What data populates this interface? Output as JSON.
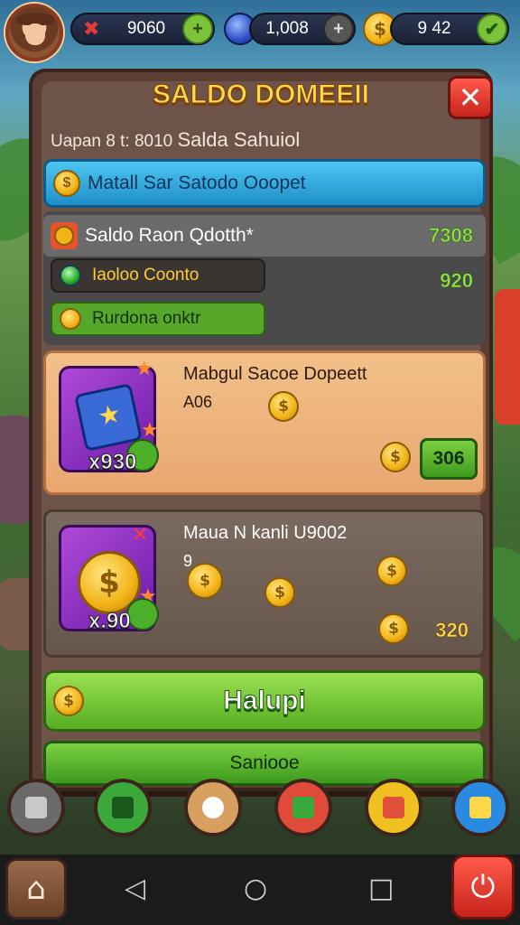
{
  "resources": {
    "lives": "9060",
    "gems": "1,008",
    "coins": "9  42"
  },
  "icons": {
    "lives": "heart-icon",
    "add": "plus-icon",
    "confirm": "check-icon",
    "close": "close-icon",
    "home": "home-icon",
    "power": "power-icon"
  },
  "panel": {
    "title": "SALDO DOMEEII",
    "close_label": "✕",
    "subline_prefix": "Uapan 8  t: 8010",
    "subline_main": "Salda Sahuiol",
    "banner": "Matall Sar Satodo Ooopet",
    "stats": {
      "row_label": "Saldo   Raon Qdotth*",
      "row_value": "7308",
      "pill_dark_label": "Iaoloo Coonto",
      "pill_dark_value": "920",
      "pill_green_label": "Rurdona onktr"
    },
    "card1": {
      "title": "Mabgul Sacoe Dopeett",
      "sub": "A06",
      "badge": "x930",
      "price": "306"
    },
    "card2": {
      "title": "Maua N kanli U9002",
      "sub": "9",
      "badge": "x.90",
      "price": "320"
    },
    "primary_button": "Halupi",
    "secondary_button": "Saniooe"
  },
  "colors": {
    "title": "#ffd84a",
    "panel": "#5b3e34",
    "accent_green": "#57ad22",
    "banner_blue": "#1e8fc9",
    "close_red": "#c7231a"
  }
}
